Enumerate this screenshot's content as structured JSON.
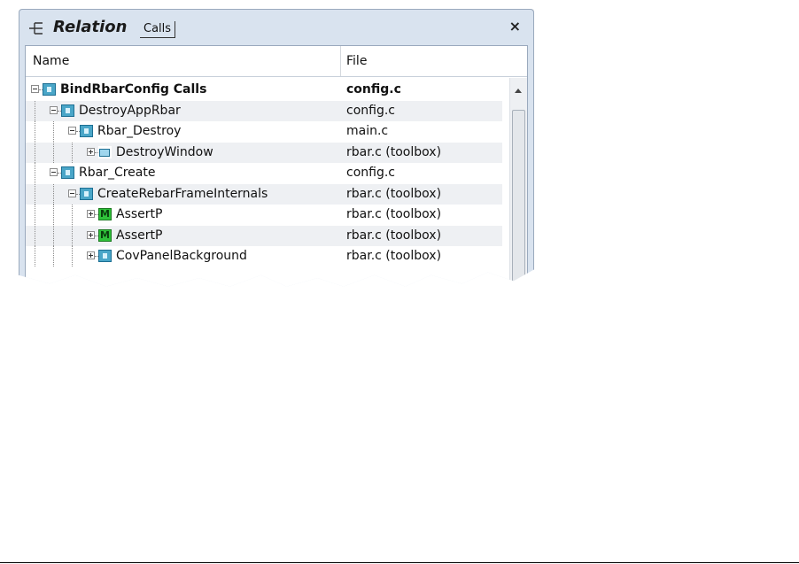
{
  "panel": {
    "title": "Relation",
    "mode_button": "Calls",
    "close_label": "×"
  },
  "columns": {
    "name": "Name",
    "file": "File"
  },
  "rows": [
    {
      "name": "BindRbarConfig Calls",
      "file": "config.c",
      "icon": "function-icon",
      "expander": "minus",
      "depth": 0,
      "bold": true
    },
    {
      "name": "DestroyAppRbar",
      "file": "config.c",
      "icon": "function-icon",
      "expander": "minus",
      "depth": 1,
      "bold": false
    },
    {
      "name": "Rbar_Destroy",
      "file": "main.c",
      "icon": "function-icon",
      "expander": "minus",
      "depth": 2,
      "bold": false
    },
    {
      "name": "DestroyWindow",
      "file": "rbar.c (toolbox)",
      "icon": "window-icon",
      "expander": "plus",
      "depth": 3,
      "bold": false
    },
    {
      "name": "Rbar_Create",
      "file": "config.c",
      "icon": "function-icon",
      "expander": "minus",
      "depth": 1,
      "bold": false
    },
    {
      "name": "CreateRebarFrameInternals",
      "file": "rbar.c (toolbox)",
      "icon": "function-icon",
      "expander": "minus",
      "depth": 2,
      "bold": false
    },
    {
      "name": "AssertP",
      "file": "rbar.c (toolbox)",
      "icon": "macro-icon",
      "expander": "plus",
      "depth": 3,
      "bold": false
    },
    {
      "name": "AssertP",
      "file": "rbar.c (toolbox)",
      "icon": "macro-icon",
      "expander": "plus",
      "depth": 3,
      "bold": false
    },
    {
      "name": "CovPanelBackground",
      "file": "rbar.c (toolbox)",
      "icon": "function-icon",
      "expander": "plus",
      "depth": 3,
      "bold": false
    }
  ]
}
